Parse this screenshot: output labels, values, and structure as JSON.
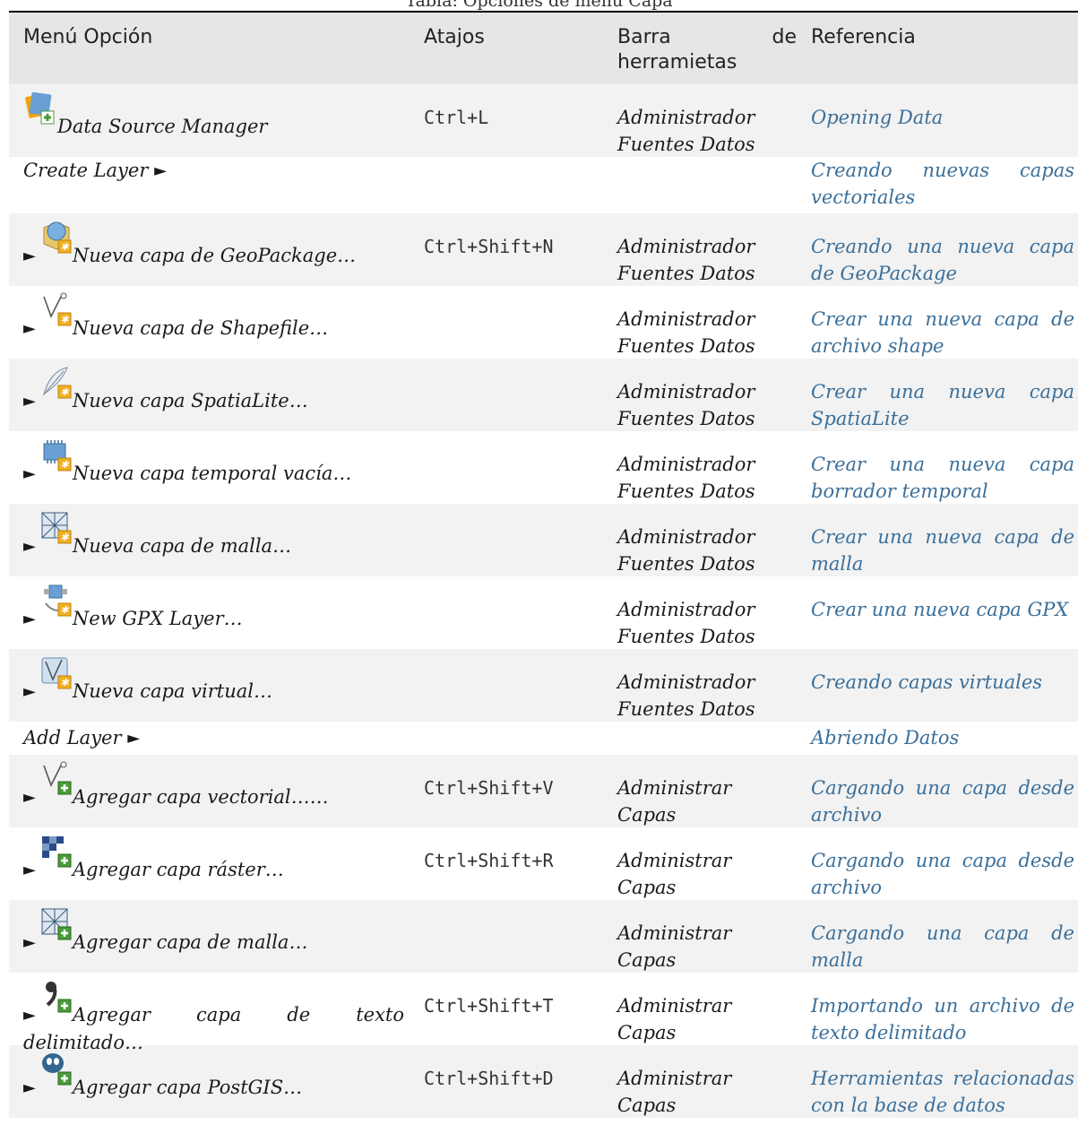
{
  "caption_fragment": "Tabla: Opciones de menú Capa",
  "columns": [
    "Menú Opción",
    "Atajos",
    "Barra de herramietas",
    "Referencia"
  ],
  "rows": [
    {
      "option": "Data Source Manager",
      "prefix": "",
      "icon": "data-source-manager-icon",
      "shortcut": "Ctrl+L",
      "toolbar": "Administrador Fuentes Datos",
      "reference": "Opening Data"
    },
    {
      "option": "Create Layer",
      "suffix": "►",
      "icon": "",
      "shortcut": "",
      "toolbar": "",
      "reference": "Creando nuevas capas vectoriales"
    },
    {
      "option": "Nueva capa de GeoPackage…",
      "prefix": "►",
      "icon": "new-geopackage-icon",
      "shortcut": "Ctrl+Shift+N",
      "toolbar": "Administrador Fuentes Datos",
      "reference": "Creando una nueva capa de GeoPackage"
    },
    {
      "option": "Nueva capa de Shapefile…",
      "prefix": "►",
      "icon": "new-shapefile-icon",
      "shortcut": "",
      "toolbar": "Administrador Fuentes Datos",
      "reference": "Crear una nueva capa de archivo shape"
    },
    {
      "option": "Nueva capa SpatiaLite…",
      "prefix": "►",
      "icon": "new-spatialite-icon",
      "shortcut": "",
      "toolbar": "Administrador Fuentes Datos",
      "reference": "Crear una nueva capa SpatiaLite"
    },
    {
      "option": "Nueva capa temporal vacía…",
      "prefix": "►",
      "icon": "new-temporary-layer-icon",
      "shortcut": "",
      "toolbar": "Administrador Fuentes Datos",
      "reference": "Crear una nueva capa borrador temporal"
    },
    {
      "option": "Nueva capa de malla…",
      "prefix": "►",
      "icon": "new-mesh-layer-icon",
      "shortcut": "",
      "toolbar": "Administrador Fuentes Datos",
      "reference": "Crear una nueva capa de malla"
    },
    {
      "option": "New GPX Layer…",
      "prefix": "►",
      "icon": "new-gpx-layer-icon",
      "shortcut": "",
      "toolbar": "Administrador Fuentes Datos",
      "reference": "Crear una nueva capa GPX"
    },
    {
      "option": "Nueva capa virtual…",
      "prefix": "►",
      "icon": "new-virtual-layer-icon",
      "shortcut": "",
      "toolbar": "Administrador Fuentes Datos",
      "reference": "Creando capas virtuales"
    },
    {
      "option": "Add Layer",
      "suffix": "►",
      "icon": "",
      "shortcut": "",
      "toolbar": "",
      "reference": "Abriendo Datos"
    },
    {
      "option": "Agregar capa vectorial……",
      "prefix": "►",
      "icon": "add-vector-layer-icon",
      "shortcut": "Ctrl+Shift+V",
      "toolbar": "Administrar Capas",
      "reference": "Cargando una capa desde archivo"
    },
    {
      "option": "Agregar capa ráster…",
      "prefix": "►",
      "icon": "add-raster-layer-icon",
      "shortcut": "Ctrl+Shift+R",
      "toolbar": "Administrar Capas",
      "reference": "Cargando una capa desde archivo"
    },
    {
      "option": "Agregar capa de malla…",
      "prefix": "►",
      "icon": "add-mesh-layer-icon",
      "shortcut": "",
      "toolbar": "Administrar Capas",
      "reference": "Cargando una capa de malla"
    },
    {
      "option": "Agregar capa de texto delimitado…",
      "prefix": "►",
      "icon": "add-delimited-text-icon",
      "shortcut": "Ctrl+Shift+T",
      "toolbar": "Administrar Capas",
      "reference": "Importando un archivo de texto delimitado"
    },
    {
      "option": "Agregar capa PostGIS…",
      "prefix": "►",
      "icon": "add-postgis-layer-icon",
      "shortcut": "Ctrl+Shift+D",
      "toolbar": "Administrar Capas",
      "reference": "Herramientas relacionadas con la base de datos"
    }
  ]
}
